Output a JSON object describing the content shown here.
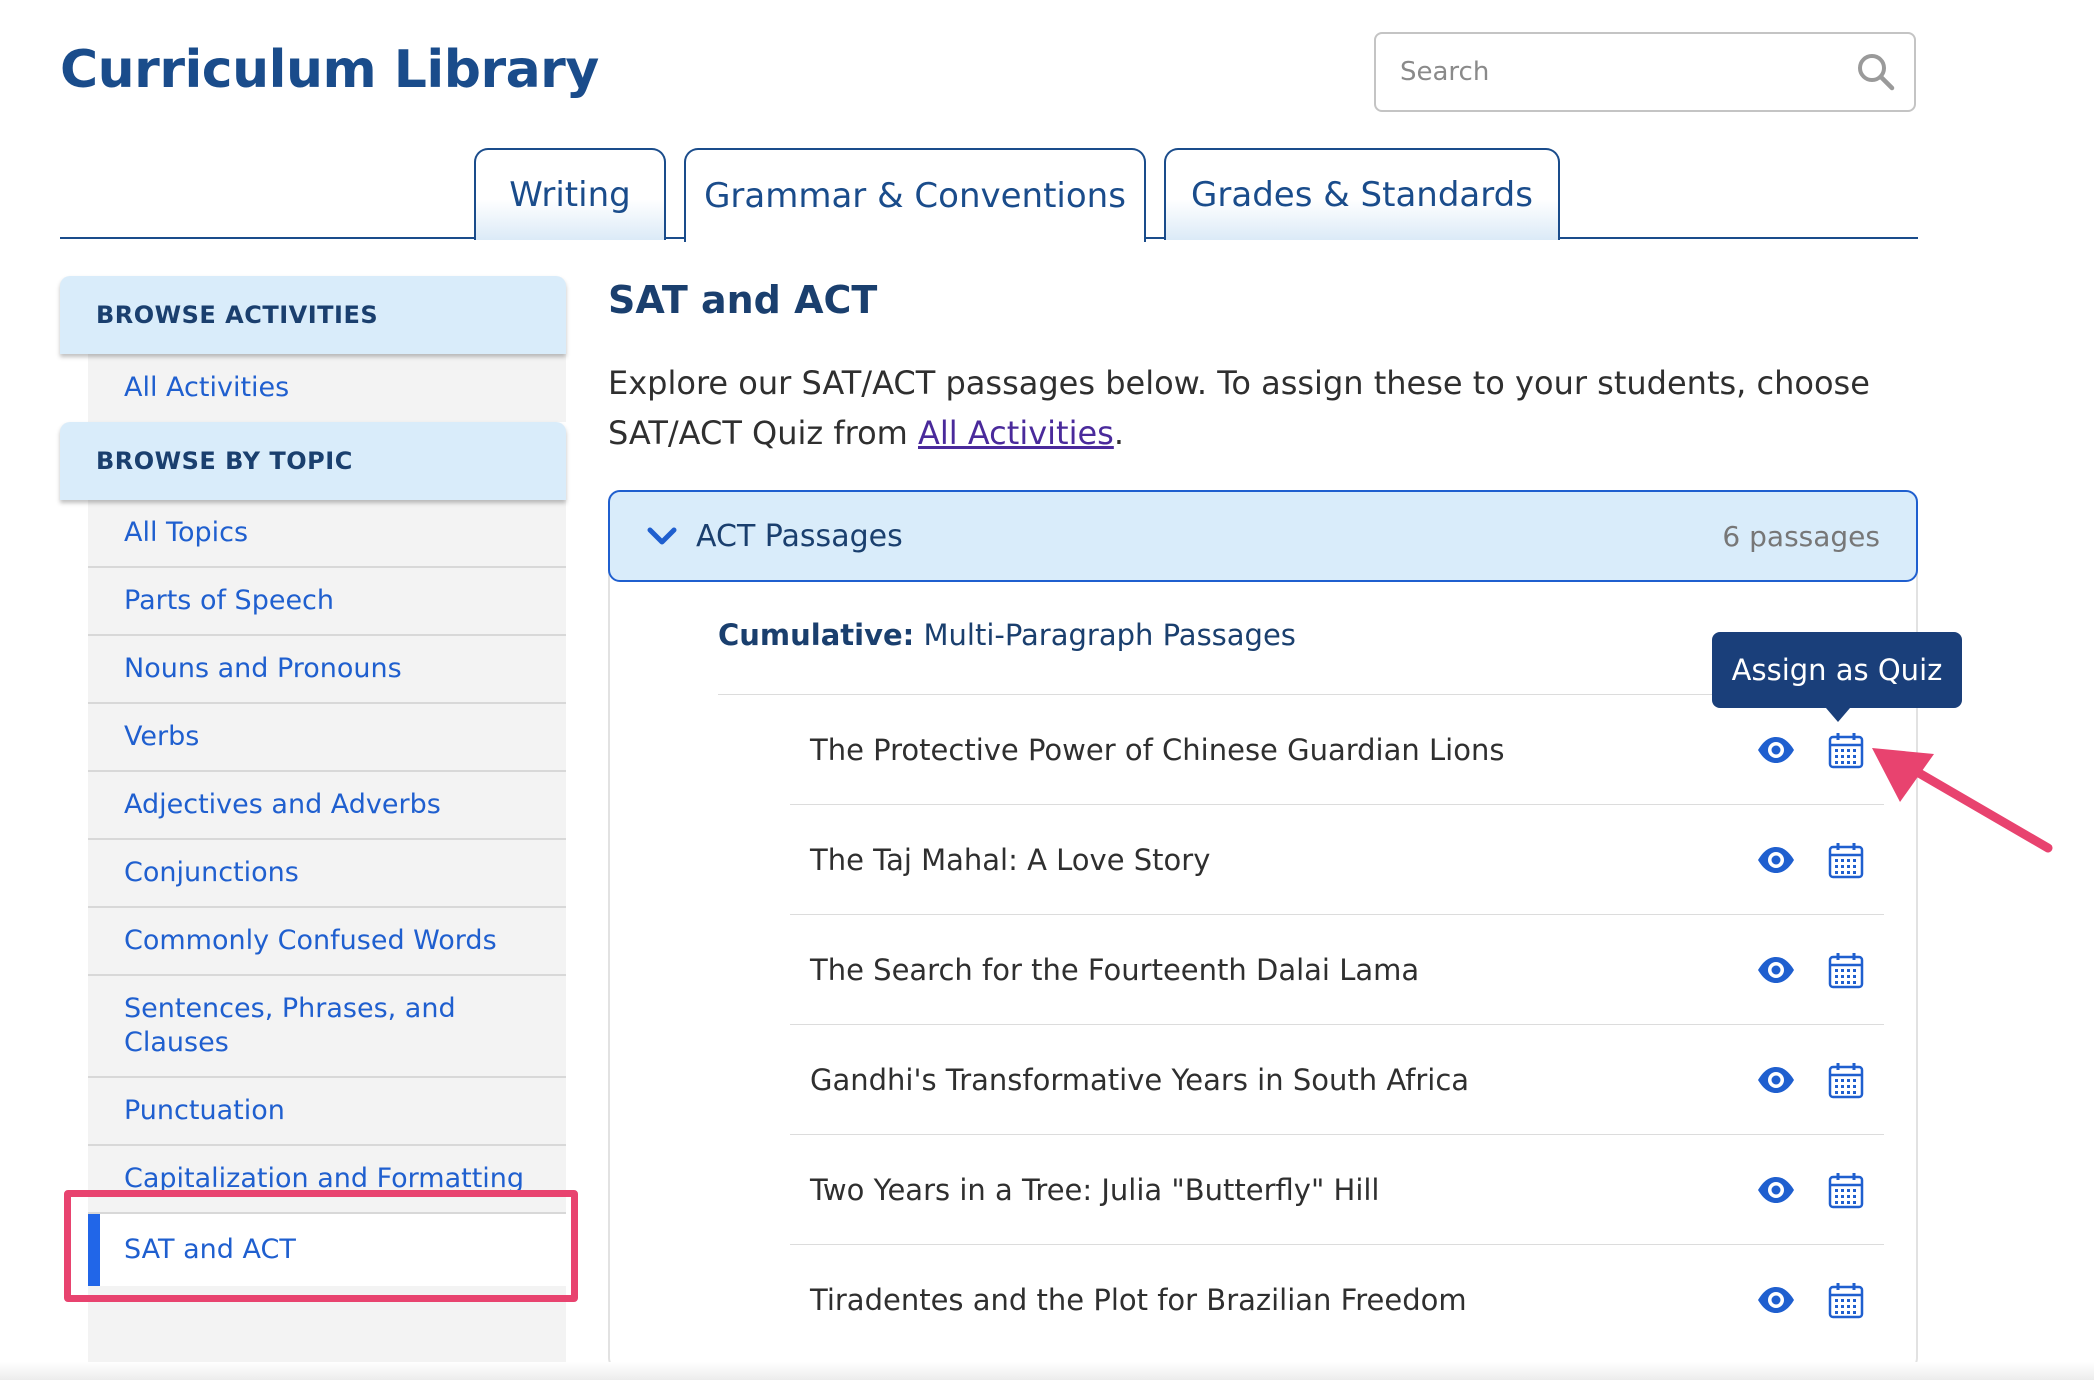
{
  "header": {
    "title": "Curriculum Library",
    "search_placeholder": "Search"
  },
  "tabs": [
    {
      "label": "Writing",
      "active": false
    },
    {
      "label": "Grammar & Conventions",
      "active": true
    },
    {
      "label": "Grades & Standards",
      "active": false
    }
  ],
  "sidebar": {
    "browse_activities_header": "BROWSE ACTIVITIES",
    "browse_activities_items": [
      "All Activities"
    ],
    "browse_topic_header": "BROWSE BY TOPIC",
    "topics": [
      "All Topics",
      "Parts of Speech",
      "Nouns and Pronouns",
      "Verbs",
      "Adjectives and Adverbs",
      "Conjunctions",
      "Commonly Confused Words",
      "Sentences, Phrases, and Clauses",
      "Punctuation",
      "Capitalization and Formatting",
      "SAT and ACT"
    ],
    "active_topic": "SAT and ACT"
  },
  "main": {
    "heading": "SAT and ACT",
    "intro_before": "Explore our SAT/ACT passages below. To assign these to your students, choose SAT/ACT Quiz from ",
    "intro_link": "All Activities",
    "intro_after": ".",
    "accordion": {
      "title": "ACT Passages",
      "count": "6 passages",
      "expanded": true,
      "subheading_bold": "Cumulative:",
      "subheading_rest": " Multi-Paragraph Passages",
      "passages": [
        "The Protective Power of Chinese Guardian Lions",
        "The Taj Mahal: A Love Story",
        "The Search for the Fourteenth Dalai Lama",
        "Gandhi's Transformative Years in South Africa",
        "Two Years in a Tree: Julia \"Butterfly\" Hill",
        "Tiradentes and the Plot for Brazilian Freedom"
      ]
    },
    "tooltip": "Assign as Quiz"
  },
  "icons": {
    "search": "search-icon",
    "chevron": "chevron-down-icon",
    "preview": "eye-icon",
    "assign": "calendar-icon"
  },
  "colors": {
    "brand": "#1a4c8b",
    "link": "#1f5fcf",
    "accent": "#2166e8",
    "annotation": "#e8436f",
    "tooltip_bg": "#1a3f7a",
    "panel_bg": "#d9ecfa"
  }
}
